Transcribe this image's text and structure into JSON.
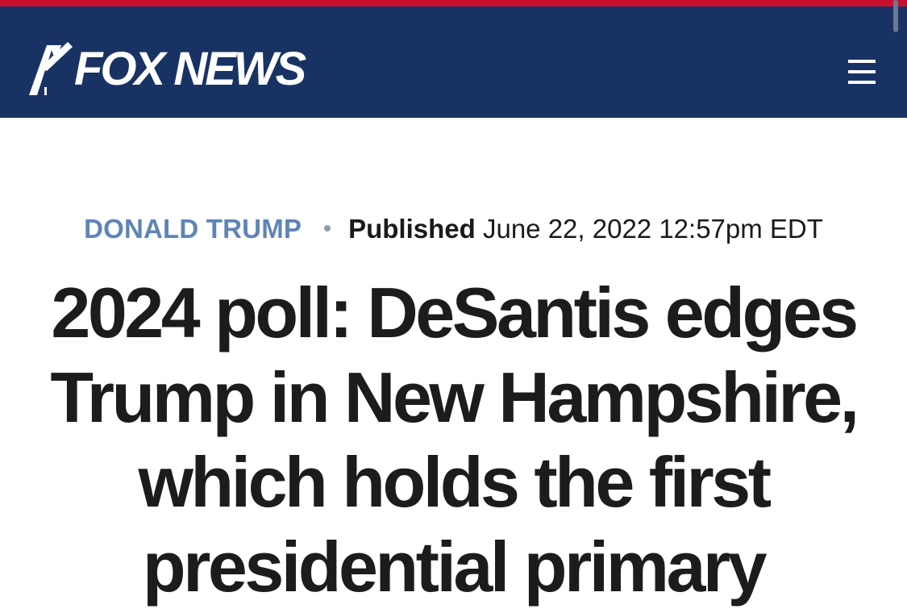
{
  "header": {
    "logo_text": "FOX NEWS",
    "logo_mark_icon": "fox-searchlight-beams-icon",
    "menu_icon": "hamburger-menu-icon",
    "background_color": "#183363",
    "accent_color": "#c8102e"
  },
  "article": {
    "category": "DONALD TRUMP",
    "category_color": "#5f84b6",
    "published_label": "Published",
    "published_date": "June 22, 2022 12:57pm EDT",
    "headline": "2024 poll: DeSantis edges Trump in New Hampshire, which holds the first presidential primary"
  }
}
